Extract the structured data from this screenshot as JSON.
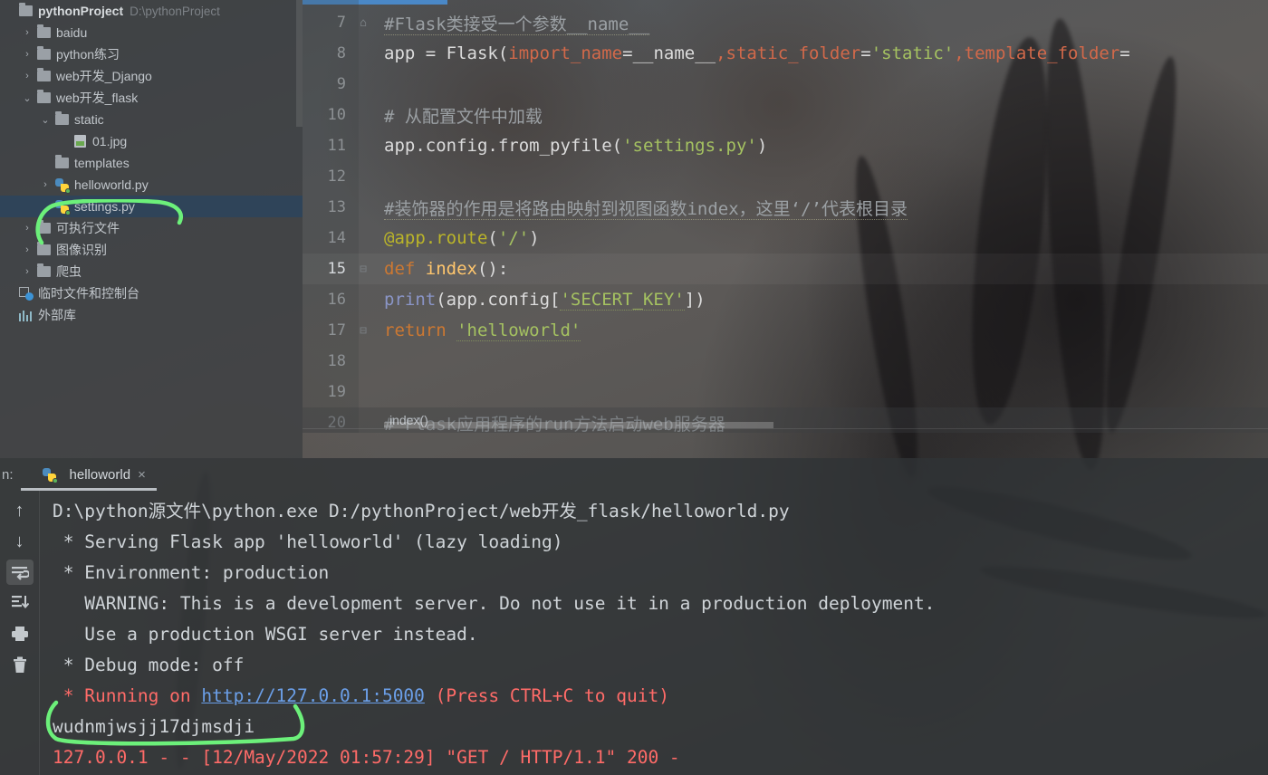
{
  "ide": {
    "name": "PyCharm",
    "accent_blue": "#4a88c7",
    "selection_navy": "#2f4459",
    "annotation_green": "#6cf07a"
  },
  "sidebar": {
    "items": [
      {
        "id": "pythonProject",
        "label": "pythonProject",
        "path": "D:\\pythonProject",
        "icon": "folder-icon",
        "arrow": "",
        "indent": 0,
        "bold": true,
        "selected": false
      },
      {
        "id": "baidu",
        "label": "baidu",
        "path": "",
        "icon": "folder-icon",
        "arrow": "›",
        "indent": 1,
        "bold": false,
        "selected": false
      },
      {
        "id": "python-lianxi",
        "label": "python练习",
        "path": "",
        "icon": "folder-icon",
        "arrow": "›",
        "indent": 1,
        "bold": false,
        "selected": false
      },
      {
        "id": "web-django",
        "label": "web开发_Django",
        "path": "",
        "icon": "folder-icon",
        "arrow": "›",
        "indent": 1,
        "bold": false,
        "selected": false
      },
      {
        "id": "web-flask",
        "label": "web开发_flask",
        "path": "",
        "icon": "folder-icon",
        "arrow": "⌄",
        "indent": 1,
        "bold": false,
        "selected": false
      },
      {
        "id": "static",
        "label": "static",
        "path": "",
        "icon": "folder-icon",
        "arrow": "⌄",
        "indent": 2,
        "bold": false,
        "selected": false
      },
      {
        "id": "01-jpg",
        "label": "01.jpg",
        "path": "",
        "icon": "image-file-icon",
        "arrow": "",
        "indent": 3,
        "bold": false,
        "selected": false
      },
      {
        "id": "templates",
        "label": "templates",
        "path": "",
        "icon": "folder-icon",
        "arrow": "",
        "indent": 2,
        "bold": false,
        "selected": false
      },
      {
        "id": "helloworld-py",
        "label": "helloworld.py",
        "path": "",
        "icon": "python-file-icon",
        "arrow": "›",
        "indent": 2,
        "bold": false,
        "selected": false
      },
      {
        "id": "settings-py",
        "label": "settings.py",
        "path": "",
        "icon": "python-file-icon",
        "arrow": "",
        "indent": 2,
        "bold": false,
        "selected": true
      },
      {
        "id": "kezhixing",
        "label": "可执行文件",
        "path": "",
        "icon": "folder-icon",
        "arrow": "›",
        "indent": 1,
        "bold": false,
        "selected": false
      },
      {
        "id": "tuxiangshibie",
        "label": "图像识别",
        "path": "",
        "icon": "folder-icon",
        "arrow": "›",
        "indent": 1,
        "bold": false,
        "selected": false
      },
      {
        "id": "pachong",
        "label": "爬虫",
        "path": "",
        "icon": "folder-icon",
        "arrow": "›",
        "indent": 1,
        "bold": false,
        "selected": false
      },
      {
        "id": "scratches",
        "label": "临时文件和控制台",
        "path": "",
        "icon": "scratches-console-icon",
        "arrow": "",
        "indent": 0,
        "bold": false,
        "selected": false
      },
      {
        "id": "external-libs",
        "label": "外部库",
        "path": "",
        "icon": "external-library-icon",
        "arrow": "",
        "indent": 0,
        "bold": false,
        "selected": false
      }
    ]
  },
  "editor": {
    "breadcrumb": "index()",
    "current_line": 15,
    "lines": [
      {
        "n": "7",
        "fold": "⌂",
        "html": "<span class='c-comment-u'>#Flask类接受一个参数__name__</span>"
      },
      {
        "n": "8",
        "fold": "",
        "html": "<span class='c-plain'>app = Flask(</span><span class='c-param'>import_name</span><span class='c-plain'>=__name__</span><span class='c-param'>,</span><span class='c-param'>static_folder</span><span class='c-plain'>=</span><span class='c-str'>'static'</span><span class='c-param'>,</span><span class='c-param'>template_folder</span><span class='c-plain'>=</span>"
      },
      {
        "n": "9",
        "fold": "",
        "html": ""
      },
      {
        "n": "10",
        "fold": "",
        "html": "<span class='c-comment'># 从配置文件中加载</span>"
      },
      {
        "n": "11",
        "fold": "",
        "html": "<span class='c-plain'>app.config.from_pyfile(</span><span class='c-str'>'settings.py'</span><span class='c-plain'>)</span>"
      },
      {
        "n": "12",
        "fold": "",
        "html": ""
      },
      {
        "n": "13",
        "fold": "",
        "html": "<span class='c-comment-u'>#装饰器的作用是将路由映射到视图函数index，这里‘/’代表根目录</span>"
      },
      {
        "n": "14",
        "fold": "",
        "html": "<span class='c-deco'>@app.route</span><span class='c-plain'>(</span><span class='c-str'>'/'</span><span class='c-plain'>)</span>"
      },
      {
        "n": "15",
        "fold": "⊟",
        "html": "<span class='c-kw'>def </span><span class='c-fn'>index</span><span class='c-plain'>():</span>"
      },
      {
        "n": "16",
        "fold": "",
        "html": "<span class='c-plain'>    </span><span class='c-builtin'>print</span><span class='c-plain'>(app.config[</span><span class='c-strline'>'SECERT_KEY'</span><span class='c-plain'>])</span>"
      },
      {
        "n": "17",
        "fold": "⊟",
        "html": "<span class='c-plain'>    </span><span class='c-kw'>return </span><span class='c-strline'>'helloworld'</span>"
      },
      {
        "n": "18",
        "fold": "",
        "html": ""
      },
      {
        "n": "19",
        "fold": "",
        "html": ""
      },
      {
        "n": "20",
        "fold": "",
        "html": "<span class='c-comment'># Flask应用程序的run方法启动web服务器</span>"
      }
    ]
  },
  "console": {
    "run_label": "n:",
    "tab_label": "helloworld",
    "tab_close": "×",
    "toolbar": [
      {
        "id": "rerun-up",
        "name": "scroll-up-icon",
        "glyph": "↑",
        "active": false
      },
      {
        "id": "rerun-down",
        "name": "scroll-down-icon",
        "glyph": "↓",
        "active": false
      },
      {
        "id": "soft-wrap",
        "name": "soft-wrap-icon",
        "glyph": "↩",
        "active": true
      },
      {
        "id": "scroll-to-end",
        "name": "scroll-to-end-icon",
        "glyph": "⇥",
        "active": false
      },
      {
        "id": "print",
        "name": "print-icon",
        "glyph": "⎙",
        "active": false
      },
      {
        "id": "clear-all",
        "name": "trash-icon",
        "glyph": "Ὕ1",
        "active": false
      }
    ],
    "lines": [
      {
        "id": "cmdline",
        "text": "D:\\python源文件\\python.exe D:/pythonProject/web开发_flask/helloworld.py",
        "style": "normal"
      },
      {
        "id": "serving",
        "text": " * Serving Flask app 'helloworld' (lazy loading)",
        "style": "normal"
      },
      {
        "id": "environment",
        "text": " * Environment: production",
        "style": "normal"
      },
      {
        "id": "warning",
        "text": "   WARNING: This is a development server. Do not use it in a production deployment.",
        "style": "normal"
      },
      {
        "id": "wsgi",
        "text": "   Use a production WSGI server instead.",
        "style": "normal"
      },
      {
        "id": "debug",
        "text": " * Debug mode: off",
        "style": "normal"
      }
    ],
    "running_prefix": " * Running on ",
    "running_url": "http://127.0.0.1:5000",
    "running_suffix": " (Press CTRL+C to quit)",
    "printed_output": "wudnmjwsjj17djmsdji",
    "access_log": "127.0.0.1 - - [12/May/2022 01:57:29] \"GET / HTTP/1.1\" 200 -"
  },
  "annotations": [
    {
      "id": "circle-settings-py",
      "target": "settings.py tree row"
    },
    {
      "id": "circle-printed-output",
      "target": "wudnmjwsjj17djmsdji console line"
    }
  ]
}
